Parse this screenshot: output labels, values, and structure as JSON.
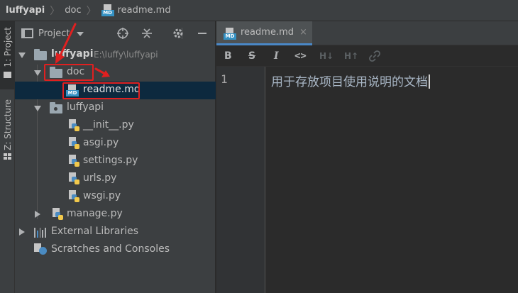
{
  "breadcrumb": {
    "items": [
      {
        "label": "luffyapi"
      },
      {
        "label": "doc"
      },
      {
        "label": "readme.md"
      }
    ],
    "md_icon_text": "MD"
  },
  "tool_strip": {
    "project_tab": "1: Project",
    "structure_tab": "Z: Structure"
  },
  "project_panel": {
    "title": "Project",
    "tree": [
      {
        "label": "luffyapi",
        "path": "E:\\luffy\\luffyapi",
        "icon": "folder-icon",
        "expanded": true
      },
      {
        "label": "doc",
        "icon": "folder-icon",
        "expanded": true
      },
      {
        "label": "readme.md",
        "icon": "markdown-file-icon",
        "selected": true
      },
      {
        "label": "luffyapi",
        "icon": "package-folder-icon",
        "expanded": true
      },
      {
        "label": "__init__.py",
        "icon": "python-file-icon"
      },
      {
        "label": "asgi.py",
        "icon": "python-file-icon"
      },
      {
        "label": "settings.py",
        "icon": "python-file-icon"
      },
      {
        "label": "urls.py",
        "icon": "python-file-icon"
      },
      {
        "label": "wsgi.py",
        "icon": "python-file-icon"
      },
      {
        "label": "manage.py",
        "icon": "python-file-icon",
        "expanded": false
      },
      {
        "label": "External Libraries",
        "icon": "library-icon",
        "expanded": false
      },
      {
        "label": "Scratches and Consoles",
        "icon": "scratch-icon"
      }
    ]
  },
  "editor": {
    "tab_label": "readme.md",
    "tab_close": "×",
    "toolbar": {
      "bold": "B",
      "strike": "S",
      "italic": "I",
      "code": "<>",
      "h_down": "H↓",
      "h_up": "H↑",
      "link": "🔗"
    },
    "line_number": "1",
    "content": "用于存放项目使用说明的文档"
  },
  "colors": {
    "annotation_red": "#e02020",
    "selection_bg": "#0d293e",
    "tab_underline": "#4a88c7"
  }
}
